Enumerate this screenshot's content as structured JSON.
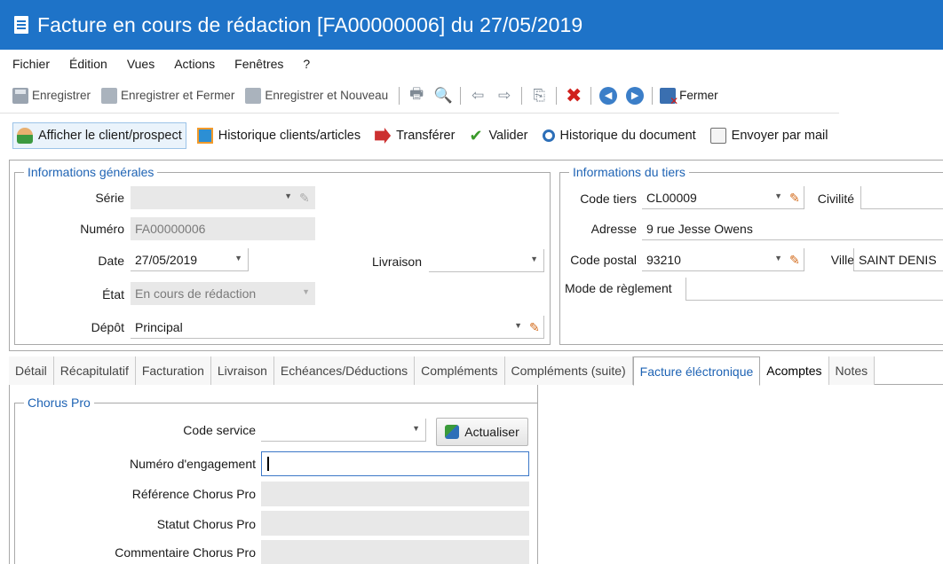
{
  "window": {
    "title": "Facture en cours de rédaction [FA00000006] du 27/05/2019"
  },
  "menu": [
    "Fichier",
    "Édition",
    "Vues",
    "Actions",
    "Fenêtres",
    "?"
  ],
  "toolbar1": {
    "save": "Enregistrer",
    "save_close": "Enregistrer et Fermer",
    "save_new": "Enregistrer et Nouveau",
    "close": "Fermer"
  },
  "toolbar2": {
    "show_client": "Afficher le client/prospect",
    "history_clients": "Historique clients/articles",
    "transfer": "Transférer",
    "validate": "Valider",
    "history_doc": "Historique du document",
    "send_mail": "Envoyer par mail"
  },
  "general": {
    "title": "Informations générales",
    "serie_label": "Série",
    "serie_value": "",
    "numero_label": "Numéro",
    "numero_value": "FA00000006",
    "date_label": "Date",
    "date_value": "27/05/2019",
    "livraison_label": "Livraison",
    "livraison_value": "",
    "etat_label": "État",
    "etat_value": "En cours de rédaction",
    "depot_label": "Dépôt",
    "depot_value": "Principal"
  },
  "tiers": {
    "title": "Informations du tiers",
    "code_label": "Code tiers",
    "code_value": "CL00009",
    "civilite_label": "Civilité",
    "civilite_value": "",
    "adresse_label": "Adresse",
    "adresse_value": "9 rue Jesse Owens",
    "cp_label": "Code postal",
    "cp_value": "93210",
    "ville_label": "Ville",
    "ville_value": "SAINT DENIS",
    "reglement_label": "Mode de règlement",
    "reglement_value": ""
  },
  "tabs": [
    "Détail",
    "Récapitulatif",
    "Facturation",
    "Livraison",
    "Echéances/Déductions",
    "Compléments",
    "Compléments (suite)",
    "Facture éléctronique",
    "Acomptes",
    "Notes"
  ],
  "chorus": {
    "title": "Chorus Pro",
    "code_service_label": "Code service",
    "code_service_value": "",
    "refresh_label": "Actualiser",
    "engagement_label": "Numéro d'engagement",
    "engagement_value": "",
    "reference_label": "Référence Chorus Pro",
    "statut_label": "Statut Chorus Pro",
    "commentaire_label": "Commentaire Chorus Pro"
  }
}
